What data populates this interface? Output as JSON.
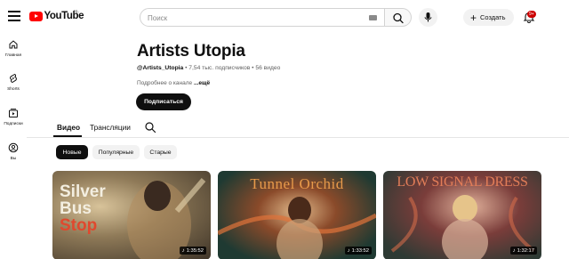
{
  "header": {
    "logo_text": "YouTube",
    "region": "NL",
    "search_placeholder": "Поиск",
    "create_label": "Создать",
    "notification_count": "9+"
  },
  "sidebar": {
    "items": [
      {
        "label": "Главная",
        "icon": "home-icon"
      },
      {
        "label": "Shorts",
        "icon": "shorts-icon"
      },
      {
        "label": "Подписки",
        "icon": "subscriptions-icon"
      },
      {
        "label": "Вы",
        "icon": "you-icon"
      }
    ]
  },
  "channel": {
    "name": "Artists Utopia",
    "handle": "@Artists_Utopia",
    "stats": " • 7,54 тыс. подписчиков • 56 видео",
    "about_prefix": "Подробнее о канале ",
    "about_more": "...ещё",
    "subscribe_label": "Подписаться"
  },
  "tabs": [
    {
      "label": "Видео",
      "active": true
    },
    {
      "label": "Трансляции",
      "active": false
    }
  ],
  "chips": [
    {
      "label": "Новые",
      "active": true
    },
    {
      "label": "Популярные",
      "active": false
    },
    {
      "label": "Старые",
      "active": false
    }
  ],
  "videos": [
    {
      "thumb_text": [
        "Silver",
        "Bus",
        "Stop"
      ],
      "duration": "1:35:52"
    },
    {
      "thumb_text": [
        "Tunnel Orchid"
      ],
      "duration": "1:33:52"
    },
    {
      "thumb_text": [
        "LOW SIGNAL DRESS"
      ],
      "duration": "1:32:17"
    }
  ],
  "colors": {
    "brand_red": "#ff0000",
    "text": "#0f0f0f",
    "muted": "#606060",
    "chip_bg": "#f2f2f2"
  }
}
